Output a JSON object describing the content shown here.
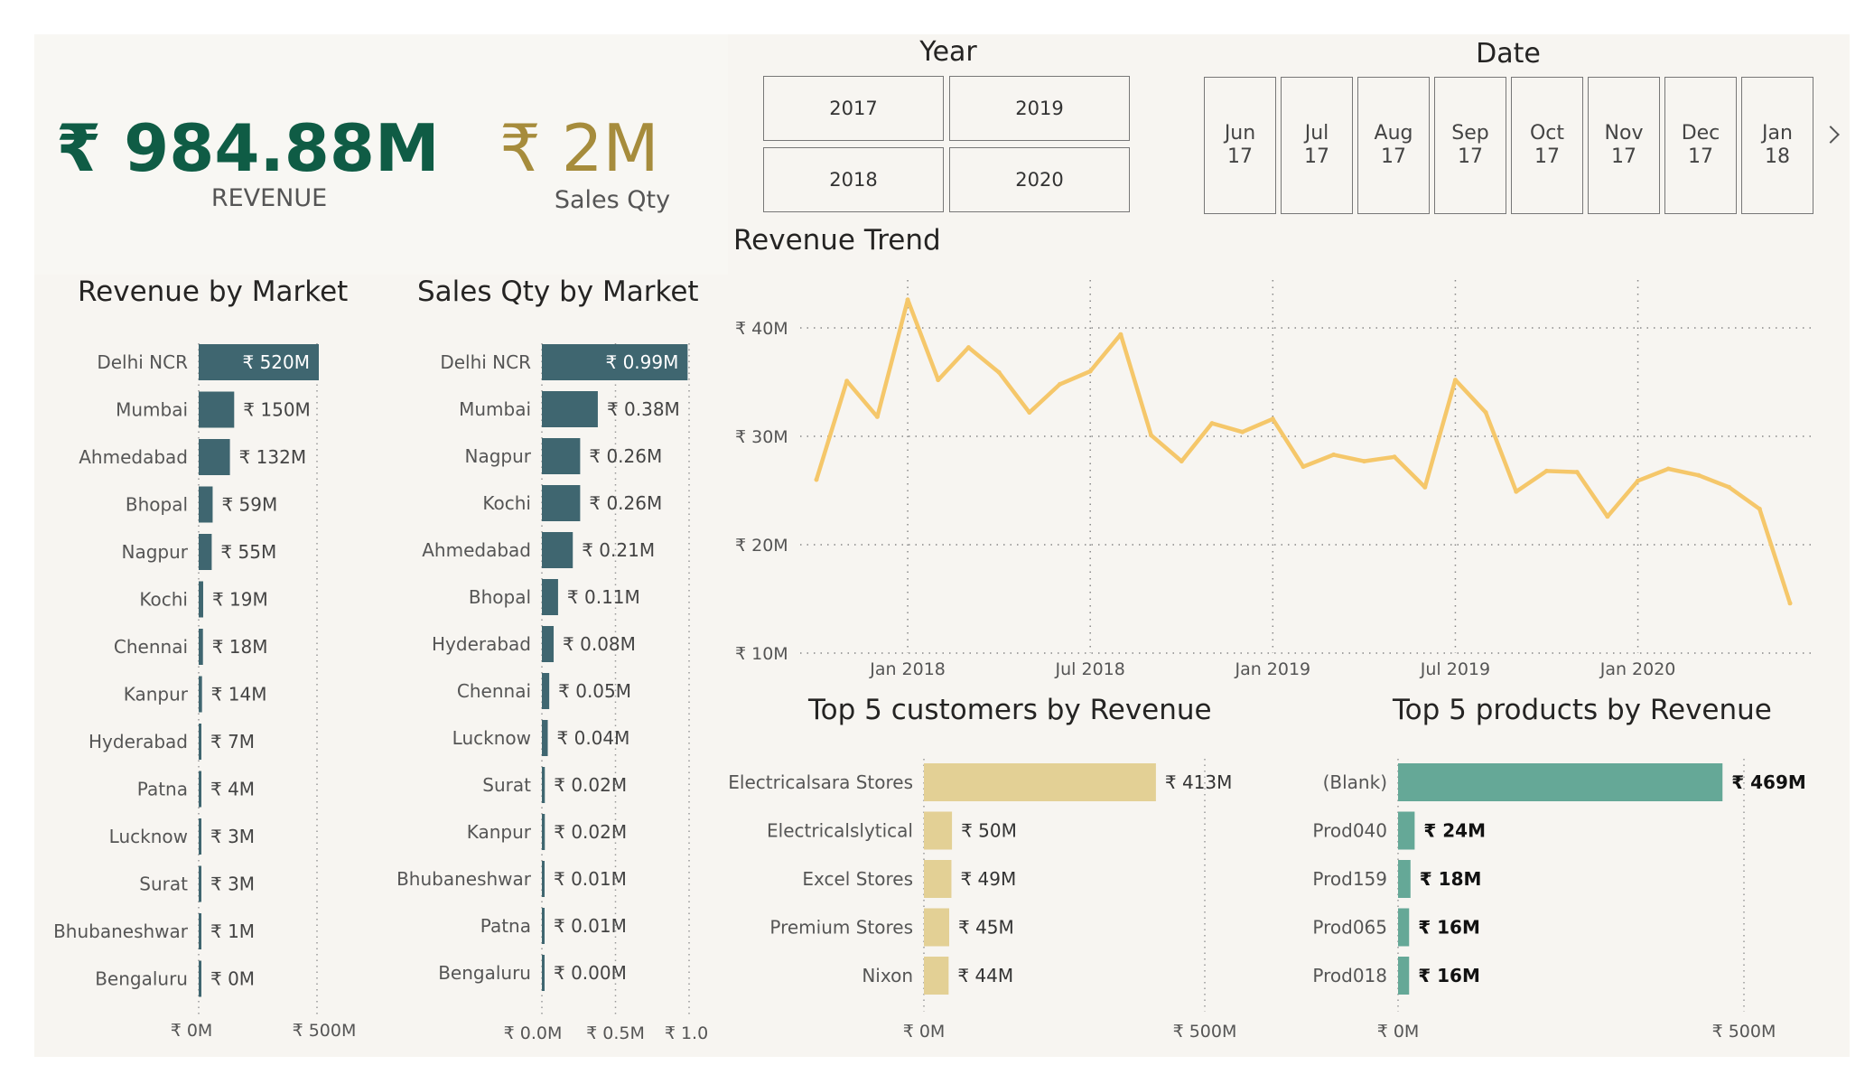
{
  "kpis": {
    "revenue_value": "₹ 984.88M",
    "revenue_label": "REVENUE",
    "qty_value": "₹ 2M",
    "qty_label": "Sales Qty",
    "revenue_color": "#0f5c45",
    "qty_color": "#a68c3c"
  },
  "slicers": {
    "year_title": "Year",
    "years": [
      "2017",
      "2019",
      "2018",
      "2020"
    ],
    "date_title": "Date",
    "dates": [
      {
        "m": "Jun",
        "y": "17"
      },
      {
        "m": "Jul",
        "y": "17"
      },
      {
        "m": "Aug",
        "y": "17"
      },
      {
        "m": "Sep",
        "y": "17"
      },
      {
        "m": "Oct",
        "y": "17"
      },
      {
        "m": "Nov",
        "y": "17"
      },
      {
        "m": "Dec",
        "y": "17"
      },
      {
        "m": "Jan",
        "y": "18"
      }
    ],
    "next_icon": "chevron-right-icon"
  },
  "colors": {
    "market_bar": "#3f6670",
    "trend_line": "#f5c76a",
    "customer_bar": "#e3d095",
    "product_bar": "#65a897",
    "panel_bg": "#f7f5f1"
  },
  "chart_data": [
    {
      "id": "revenue_by_market",
      "type": "bar",
      "orientation": "horizontal",
      "title": "Revenue by Market",
      "categories": [
        "Delhi NCR",
        "Mumbai",
        "Ahmedabad",
        "Bhopal",
        "Nagpur",
        "Kochi",
        "Chennai",
        "Kanpur",
        "Hyderabad",
        "Patna",
        "Lucknow",
        "Surat",
        "Bhubaneshwar",
        "Bengaluru"
      ],
      "values": [
        520,
        150,
        132,
        59,
        55,
        19,
        18,
        14,
        7,
        4,
        3,
        3,
        1,
        0
      ],
      "value_labels": [
        "₹ 520M",
        "₹ 150M",
        "₹ 132M",
        "₹ 59M",
        "₹ 55M",
        "₹ 19M",
        "₹ 18M",
        "₹ 14M",
        "₹ 7M",
        "₹ 4M",
        "₹ 3M",
        "₹ 3M",
        "₹ 1M",
        "₹ 0M"
      ],
      "unit": "M",
      "xlim": [
        0,
        500
      ],
      "ticks": [
        0,
        500
      ],
      "tick_labels": [
        "₹ 0M",
        "₹ 500M"
      ]
    },
    {
      "id": "sales_qty_by_market",
      "type": "bar",
      "orientation": "horizontal",
      "title": "Sales Qty by Market",
      "categories": [
        "Delhi NCR",
        "Mumbai",
        "Nagpur",
        "Kochi",
        "Ahmedabad",
        "Bhopal",
        "Hyderabad",
        "Chennai",
        "Lucknow",
        "Surat",
        "Kanpur",
        "Bhubaneshwar",
        "Patna",
        "Bengaluru"
      ],
      "values": [
        0.99,
        0.38,
        0.26,
        0.26,
        0.21,
        0.11,
        0.08,
        0.05,
        0.04,
        0.02,
        0.02,
        0.01,
        0.01,
        0.0
      ],
      "value_labels": [
        "₹ 0.99M",
        "₹ 0.38M",
        "₹ 0.26M",
        "₹ 0.26M",
        "₹ 0.21M",
        "₹ 0.11M",
        "₹ 0.08M",
        "₹ 0.05M",
        "₹ 0.04M",
        "₹ 0.02M",
        "₹ 0.02M",
        "₹ 0.01M",
        "₹ 0.01M",
        "₹ 0.00M"
      ],
      "unit": "M",
      "xlim": [
        0,
        1.0
      ],
      "ticks": [
        0,
        0.5,
        1.0
      ],
      "tick_labels": [
        "₹ 0.0M",
        "₹ 0.5M",
        "₹ 1.0"
      ]
    },
    {
      "id": "revenue_trend",
      "type": "line",
      "title": "Revenue Trend",
      "x": [
        "2017-10",
        "2017-11",
        "2017-12",
        "2018-01",
        "2018-02",
        "2018-03",
        "2018-04",
        "2018-05",
        "2018-06",
        "2018-07",
        "2018-08",
        "2018-09",
        "2018-10",
        "2018-11",
        "2018-12",
        "2019-01",
        "2019-02",
        "2019-03",
        "2019-04",
        "2019-05",
        "2019-06",
        "2019-07",
        "2019-08",
        "2019-09",
        "2019-10",
        "2019-11",
        "2019-12",
        "2020-01",
        "2020-02",
        "2020-03",
        "2020-04",
        "2020-05",
        "2020-06"
      ],
      "values": [
        26.0,
        35.1,
        31.8,
        42.6,
        35.2,
        38.2,
        35.9,
        32.2,
        34.8,
        36.0,
        39.4,
        30.1,
        27.7,
        31.2,
        30.4,
        31.6,
        27.2,
        28.3,
        27.7,
        28.1,
        25.3,
        35.2,
        32.2,
        24.9,
        26.8,
        26.7,
        22.6,
        25.9,
        27.0,
        26.4,
        25.3,
        23.3,
        14.6
      ],
      "unit": "M",
      "ylim": [
        10,
        40
      ],
      "yticks": [
        10,
        20,
        30,
        40
      ],
      "ytick_labels": [
        "₹ 10M",
        "₹ 20M",
        "₹ 30M",
        "₹ 40M"
      ],
      "xticks": [
        "2018-01",
        "2018-07",
        "2019-01",
        "2019-07",
        "2020-01"
      ],
      "xtick_labels": [
        "Jan 2018",
        "Jul 2018",
        "Jan 2019",
        "Jul 2019",
        "Jan 2020"
      ],
      "grid": true
    },
    {
      "id": "top5_customers",
      "type": "bar",
      "orientation": "horizontal",
      "title": "Top 5 customers by Revenue",
      "categories": [
        "Electricalsara Stores",
        "Electricalslytical",
        "Excel Stores",
        "Premium Stores",
        "Nixon"
      ],
      "values": [
        413,
        50,
        49,
        45,
        44
      ],
      "value_labels": [
        "₹ 413M",
        "₹ 50M",
        "₹ 49M",
        "₹ 45M",
        "₹ 44M"
      ],
      "unit": "M",
      "xlim": [
        0,
        500
      ],
      "ticks": [
        0,
        500
      ],
      "tick_labels": [
        "₹ 0M",
        "₹ 500M"
      ]
    },
    {
      "id": "top5_products",
      "type": "bar",
      "orientation": "horizontal",
      "title": "Top 5 products by Revenue",
      "categories": [
        "(Blank)",
        "Prod040",
        "Prod159",
        "Prod065",
        "Prod018"
      ],
      "values": [
        469,
        24,
        18,
        16,
        16
      ],
      "value_labels": [
        "₹ 469M",
        "₹ 24M",
        "₹ 18M",
        "₹ 16M",
        "₹ 16M"
      ],
      "unit": "M",
      "xlim": [
        0,
        500
      ],
      "ticks": [
        0,
        500
      ],
      "tick_labels": [
        "₹ 0M",
        "₹ 500M"
      ]
    }
  ]
}
